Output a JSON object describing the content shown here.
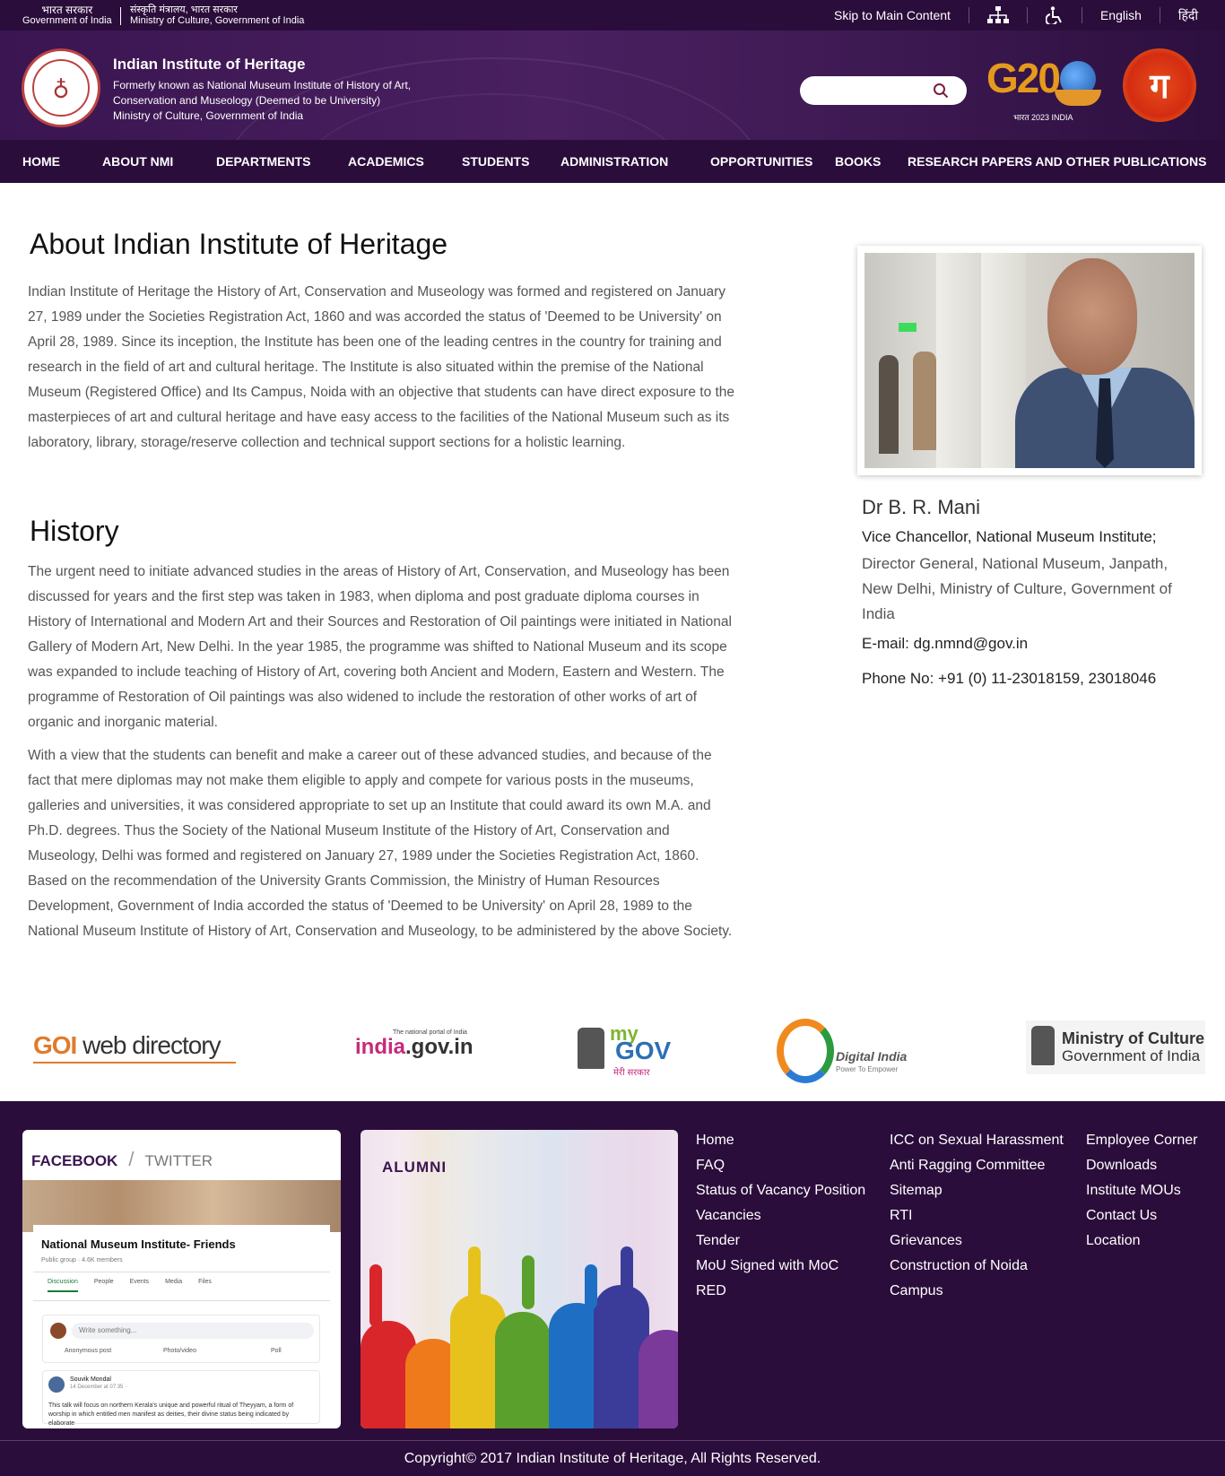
{
  "topbar": {
    "gov_hi": "भारत सरकार",
    "gov_en": "Government of India",
    "ministry_hi": "संस्कृति मंत्रालय, भारत सरकार",
    "ministry_en": "Ministry of Culture, Government of India",
    "skip": "Skip to Main Content",
    "sitemap_icon": "sitemap-icon",
    "accessibility_icon": "accessibility-icon",
    "lang_en": "English",
    "lang_hi": "हिंदी"
  },
  "header": {
    "name": "Indian Institute of Heritage",
    "sub1": "Formerly known as National Museum Institute of History of Art,",
    "sub2": "Conservation and Museology (Deemed to be University)",
    "sub3": "Ministry of Culture, Government of India",
    "search_placeholder": "",
    "g20_text": "G20",
    "g20_caption": "भारत 2023 INDIA",
    "amrit_text": "ग"
  },
  "nav": [
    "HOME",
    "ABOUT NMI",
    "DEPARTMENTS",
    "ACADEMICS",
    "STUDENTS",
    "ADMINISTRATION",
    "OPPORTUNITIES",
    "BOOKS",
    "RESEARCH PAPERS AND OTHER PUBLICATIONS"
  ],
  "about": {
    "title": "About Indian Institute of Heritage",
    "text": "Indian Institute of Heritage the History of Art, Conservation and Museology was formed and registered on January 27, 1989 under the Societies Registration Act, 1860 and was accorded the status of 'Deemed to be University' on April 28, 1989. Since its inception, the Institute has been one of the leading centres in the country for training and research in the field of art and cultural heritage. The Institute is also situated within the premise of the National Museum (Registered Office) and Its Campus, Noida with an objective that students can have direct exposure to the masterpieces of art and cultural heritage and have easy access to the facilities of the National Museum such as its laboratory, library, storage/reserve collection and technical support sections for a holistic learning."
  },
  "history": {
    "title": "History",
    "p1": "The urgent need to initiate advanced studies in the areas of History of Art, Conservation, and Museology has been discussed for years and the first step was taken in 1983, when diploma and post graduate diploma courses in History of International and Modern Art and their Sources and Restoration of Oil paintings were initiated in National Gallery of Modern Art, New Delhi. In the year 1985, the programme was shifted to National Museum and its scope was expanded to include teaching of History of Art, covering both Ancient and Modern, Eastern and Western. The programme of Restoration of Oil paintings was also widened to include the restoration of other works of art of organic and inorganic material.",
    "p2": "With a view that the students can benefit and make a career out of these advanced studies, and because of the fact that mere diplomas may not make them eligible to apply and compete for various posts in the museums, galleries and universities, it was considered appropriate to set up an Institute that could award its own M.A. and Ph.D. degrees. Thus the Society of the National Museum Institute of the History of Art, Conservation and Museology, Delhi was formed and registered on January 27, 1989 under the Societies Registration Act, 1860. Based on the recommendation of the University Grants Commission, the Ministry of Human Resources Development, Government of India accorded the status of 'Deemed to be University' on April 28, 1989 to the National Museum Institute of History of Art, Conservation and Museology, to be administered by the above Society."
  },
  "vc": {
    "name": "Dr B. R. Mani",
    "role": "Vice Chancellor, National Museum Institute;",
    "desc": "Director General, National Museum, Janpath, New Delhi, Ministry of Culture, Government of India",
    "email": "E-mail: dg.nmnd@gov.in",
    "phone": "Phone No: +91 (0) 11-23018159, 23018046"
  },
  "partners": {
    "goi_a": "GOI",
    "goi_b": " web directory",
    "indiagov_small": "The national portal of India",
    "indiagov_a": "india",
    "indiagov_b": ".gov.in",
    "mygov_a": "my",
    "mygov_b": "GOV",
    "mygov_c": "मेरी सरकार",
    "digital_a": "Digital India",
    "digital_b": "Power To Empower",
    "moc_a": "Ministry of Culture",
    "moc_b": "Government of India"
  },
  "footer": {
    "social_facebook": "FACEBOOK",
    "social_sep": "/",
    "social_twitter": "TWITTER",
    "fb_group_name": "National Museum Institute- Friends",
    "fb_group_meta": "Public group · 4.6K members",
    "fb_tabs": [
      "Discussion",
      "People",
      "Events",
      "Media",
      "Files"
    ],
    "fb_write": "Write something...",
    "fb_opts": [
      "Anonymous post",
      "Photo/video",
      "Poll"
    ],
    "fb_post_name": "Souvik Mondal",
    "fb_post_date": "14 December at 07:35 · ",
    "fb_post_body": "This talk will focus on northern Kerala's unique and powerful ritual of Theyyam, a form of worship in which entitled men manifest as deities, their divine status being indicated by elaborate",
    "alumni": "ALUMNI",
    "col1": [
      "Home",
      "FAQ",
      "Status of Vacancy Position",
      "Vacancies",
      "Tender",
      "MoU Signed with MoC",
      "RED"
    ],
    "col2": [
      "ICC on Sexual Harassment",
      "Anti Ragging Committee",
      "Sitemap",
      "RTI",
      "Grievances",
      "Construction of Noida",
      "Campus"
    ],
    "col3": [
      "Employee Corner",
      "Downloads",
      "Institute MOUs",
      "Contact Us",
      "Location"
    ],
    "copyright": "Copyright© 2017 Indian Institute of Heritage, All Rights Reserved."
  }
}
